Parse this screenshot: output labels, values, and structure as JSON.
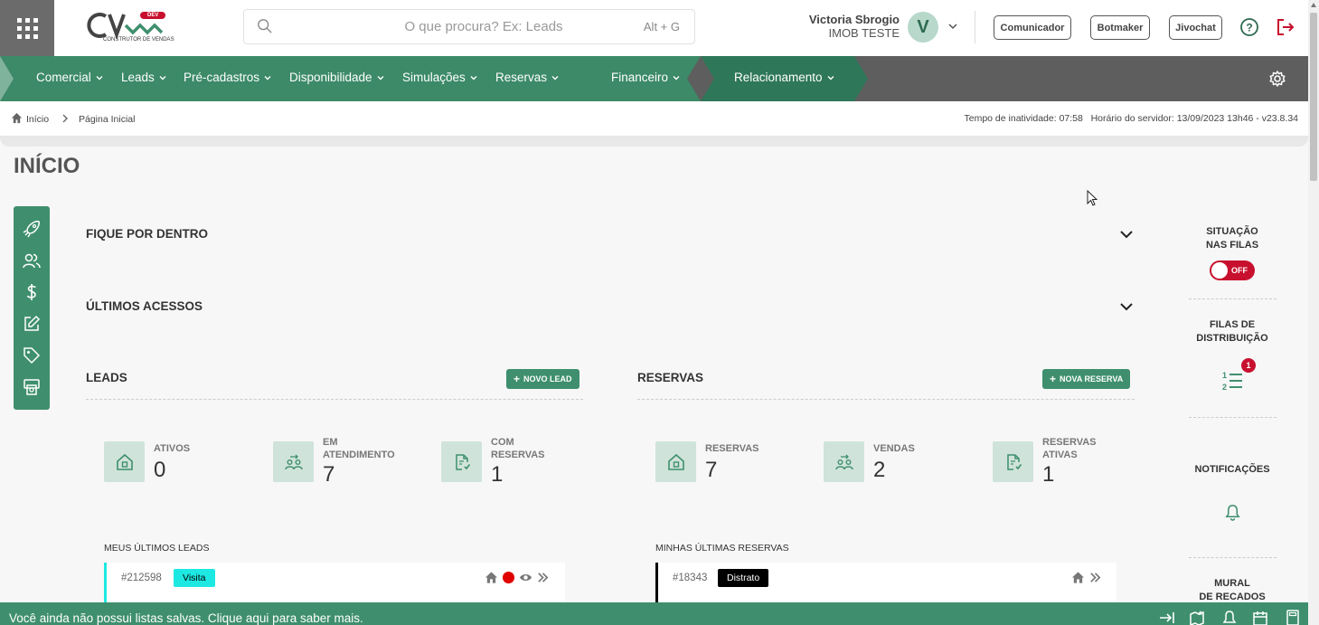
{
  "header": {
    "logo_text": "CV",
    "logo_badge": "DEV",
    "logo_subtitle": "CONSTRUTOR DE VENDAS",
    "search_placeholder": "O que procura? Ex: Leads",
    "search_shortcut": "Alt + G",
    "user_name": "Victoria Sbrogio",
    "user_company": "IMOB TESTE",
    "avatar_initial": "V",
    "buttons": [
      "Comunicador",
      "Botmaker",
      "Jivochat"
    ]
  },
  "nav": {
    "items": [
      "Comercial",
      "Leads",
      "Pré-cadastros",
      "Disponibilidade",
      "Simulações",
      "Reservas",
      "Financeiro",
      "Relacionamento"
    ]
  },
  "breadcrumb": {
    "home": "Início",
    "current": "Página Inicial",
    "server_info": "Tempo de inatividade: 07:58   Horário do servidor: 13/09/2023 13h46 - v23.8.34"
  },
  "page": {
    "title": "INÍCIO",
    "section_news": "FIQUE POR DENTRO",
    "section_recent": "ÚLTIMOS ACESSOS"
  },
  "leads": {
    "title": "LEADS",
    "new_button": "NOVO LEAD",
    "stats": [
      {
        "label": "ATIVOS",
        "value": "0"
      },
      {
        "label": "EM ATENDIMENTO",
        "label1": "EM",
        "label2": "ATENDIMENTO",
        "value": "7"
      },
      {
        "label1": "COM",
        "label2": "RESERVAS",
        "value": "1"
      }
    ],
    "list_title": "MEUS ÚLTIMOS LEADS",
    "first_card": {
      "id": "#212598",
      "badge": "Visita"
    }
  },
  "reservas": {
    "title": "RESERVAS",
    "new_button": "NOVA RESERVA",
    "stats": [
      {
        "label": "RESERVAS",
        "value": "7"
      },
      {
        "label": "VENDAS",
        "value": "2"
      },
      {
        "label1": "RESERVAS",
        "label2": "ATIVAS",
        "value": "1"
      }
    ],
    "list_title": "MINHAS ÚLTIMAS RESERVAS",
    "first_card": {
      "id": "#18343",
      "badge": "Distrato"
    }
  },
  "right_panel": {
    "queue_title1": "SITUAÇÃO",
    "queue_title2": "NAS FILAS",
    "toggle_label": "OFF",
    "dist_title1": "FILAS DE",
    "dist_title2": "DISTRIBUIÇÃO",
    "dist_badge": "1",
    "notif_title": "NOTIFICAÇÕES",
    "mural_title1": "MURAL",
    "mural_title2": "DE RECADOS"
  },
  "bottom": {
    "message": "Você ainda não possui listas salvas. Clique aqui para saber mais."
  },
  "colors": {
    "brand_green": "#3f8f6e",
    "nav_green": "#3c8a68",
    "nav_gray": "#5e5e5e",
    "alert_red": "#c8102e",
    "visita_badge": "#1de9e2",
    "distrato_badge": "#000000"
  }
}
